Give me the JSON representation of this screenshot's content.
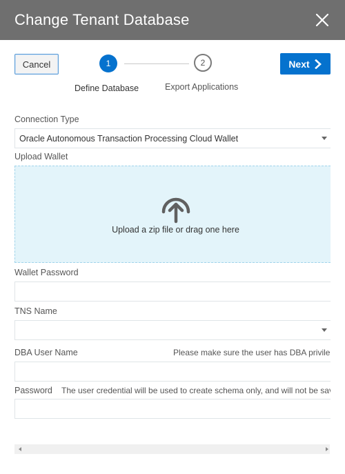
{
  "dialog": {
    "title": "Change Tenant Database"
  },
  "toolbar": {
    "cancel_label": "Cancel",
    "next_label": "Next"
  },
  "steps": [
    {
      "number": "1",
      "label": "Define Database"
    },
    {
      "number": "2",
      "label": "Export Applications"
    }
  ],
  "form": {
    "connection_type": {
      "label": "Connection Type",
      "value": "Oracle Autonomous Transaction Processing Cloud Wallet"
    },
    "upload_wallet": {
      "label": "Upload Wallet",
      "dropzone_text": "Upload a zip file or drag one here"
    },
    "wallet_password": {
      "label": "Wallet Password",
      "value": ""
    },
    "tns_name": {
      "label": "TNS Name",
      "value": ""
    },
    "dba_user_name": {
      "label": "DBA User Name",
      "hint": "Please make sure the user has DBA privilege",
      "value": ""
    },
    "password": {
      "label": "Password",
      "hint": "The user credential will be used to create schema only, and will not be saved",
      "value": ""
    }
  },
  "icons": {
    "close": "close-icon",
    "next": "chevron-right-icon",
    "upload": "upload-arrow-icon"
  },
  "colors": {
    "accent": "#0572ce",
    "titlebar": "#6f6f6f",
    "dropzone": "#e3f4fa"
  }
}
